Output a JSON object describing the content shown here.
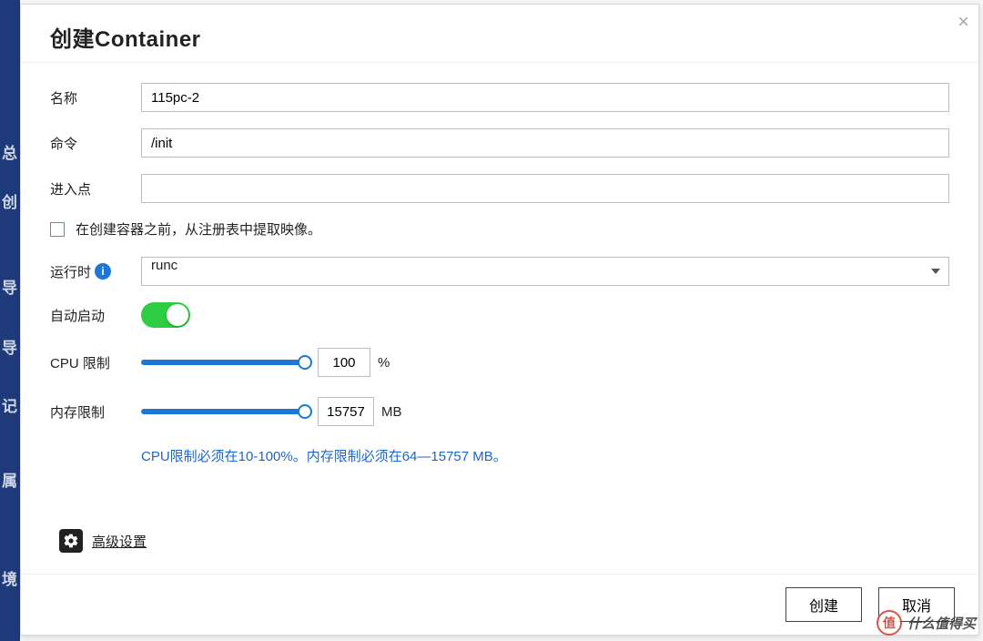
{
  "modal": {
    "title": "创建Container",
    "labels": {
      "name": "名称",
      "command": "命令",
      "entrypoint": "进入点",
      "runtime": "运行时",
      "autostart": "自动启动",
      "cpu_limit": "CPU 限制",
      "mem_limit": "内存限制"
    },
    "values": {
      "name": "115pc-2",
      "command": "/init",
      "entrypoint": "",
      "runtime_selected": "runc",
      "pull_image_checked": false,
      "autostart_on": true,
      "cpu_percent": "100",
      "cpu_unit": "%",
      "mem_mb": "15757",
      "mem_unit": "MB"
    },
    "checkbox_label": "在创建容器之前，从注册表中提取映像。",
    "hint": "CPU限制必须在10-100%。内存限制必须在64—15757 MB。",
    "advanced_label": "高级设置",
    "buttons": {
      "create": "创建",
      "cancel": "取消"
    }
  },
  "watermark": {
    "badge": "值",
    "text": "什么值得买"
  },
  "bg_sidebar": [
    "总",
    "创",
    "导",
    "导",
    "记",
    "属",
    "境"
  ]
}
